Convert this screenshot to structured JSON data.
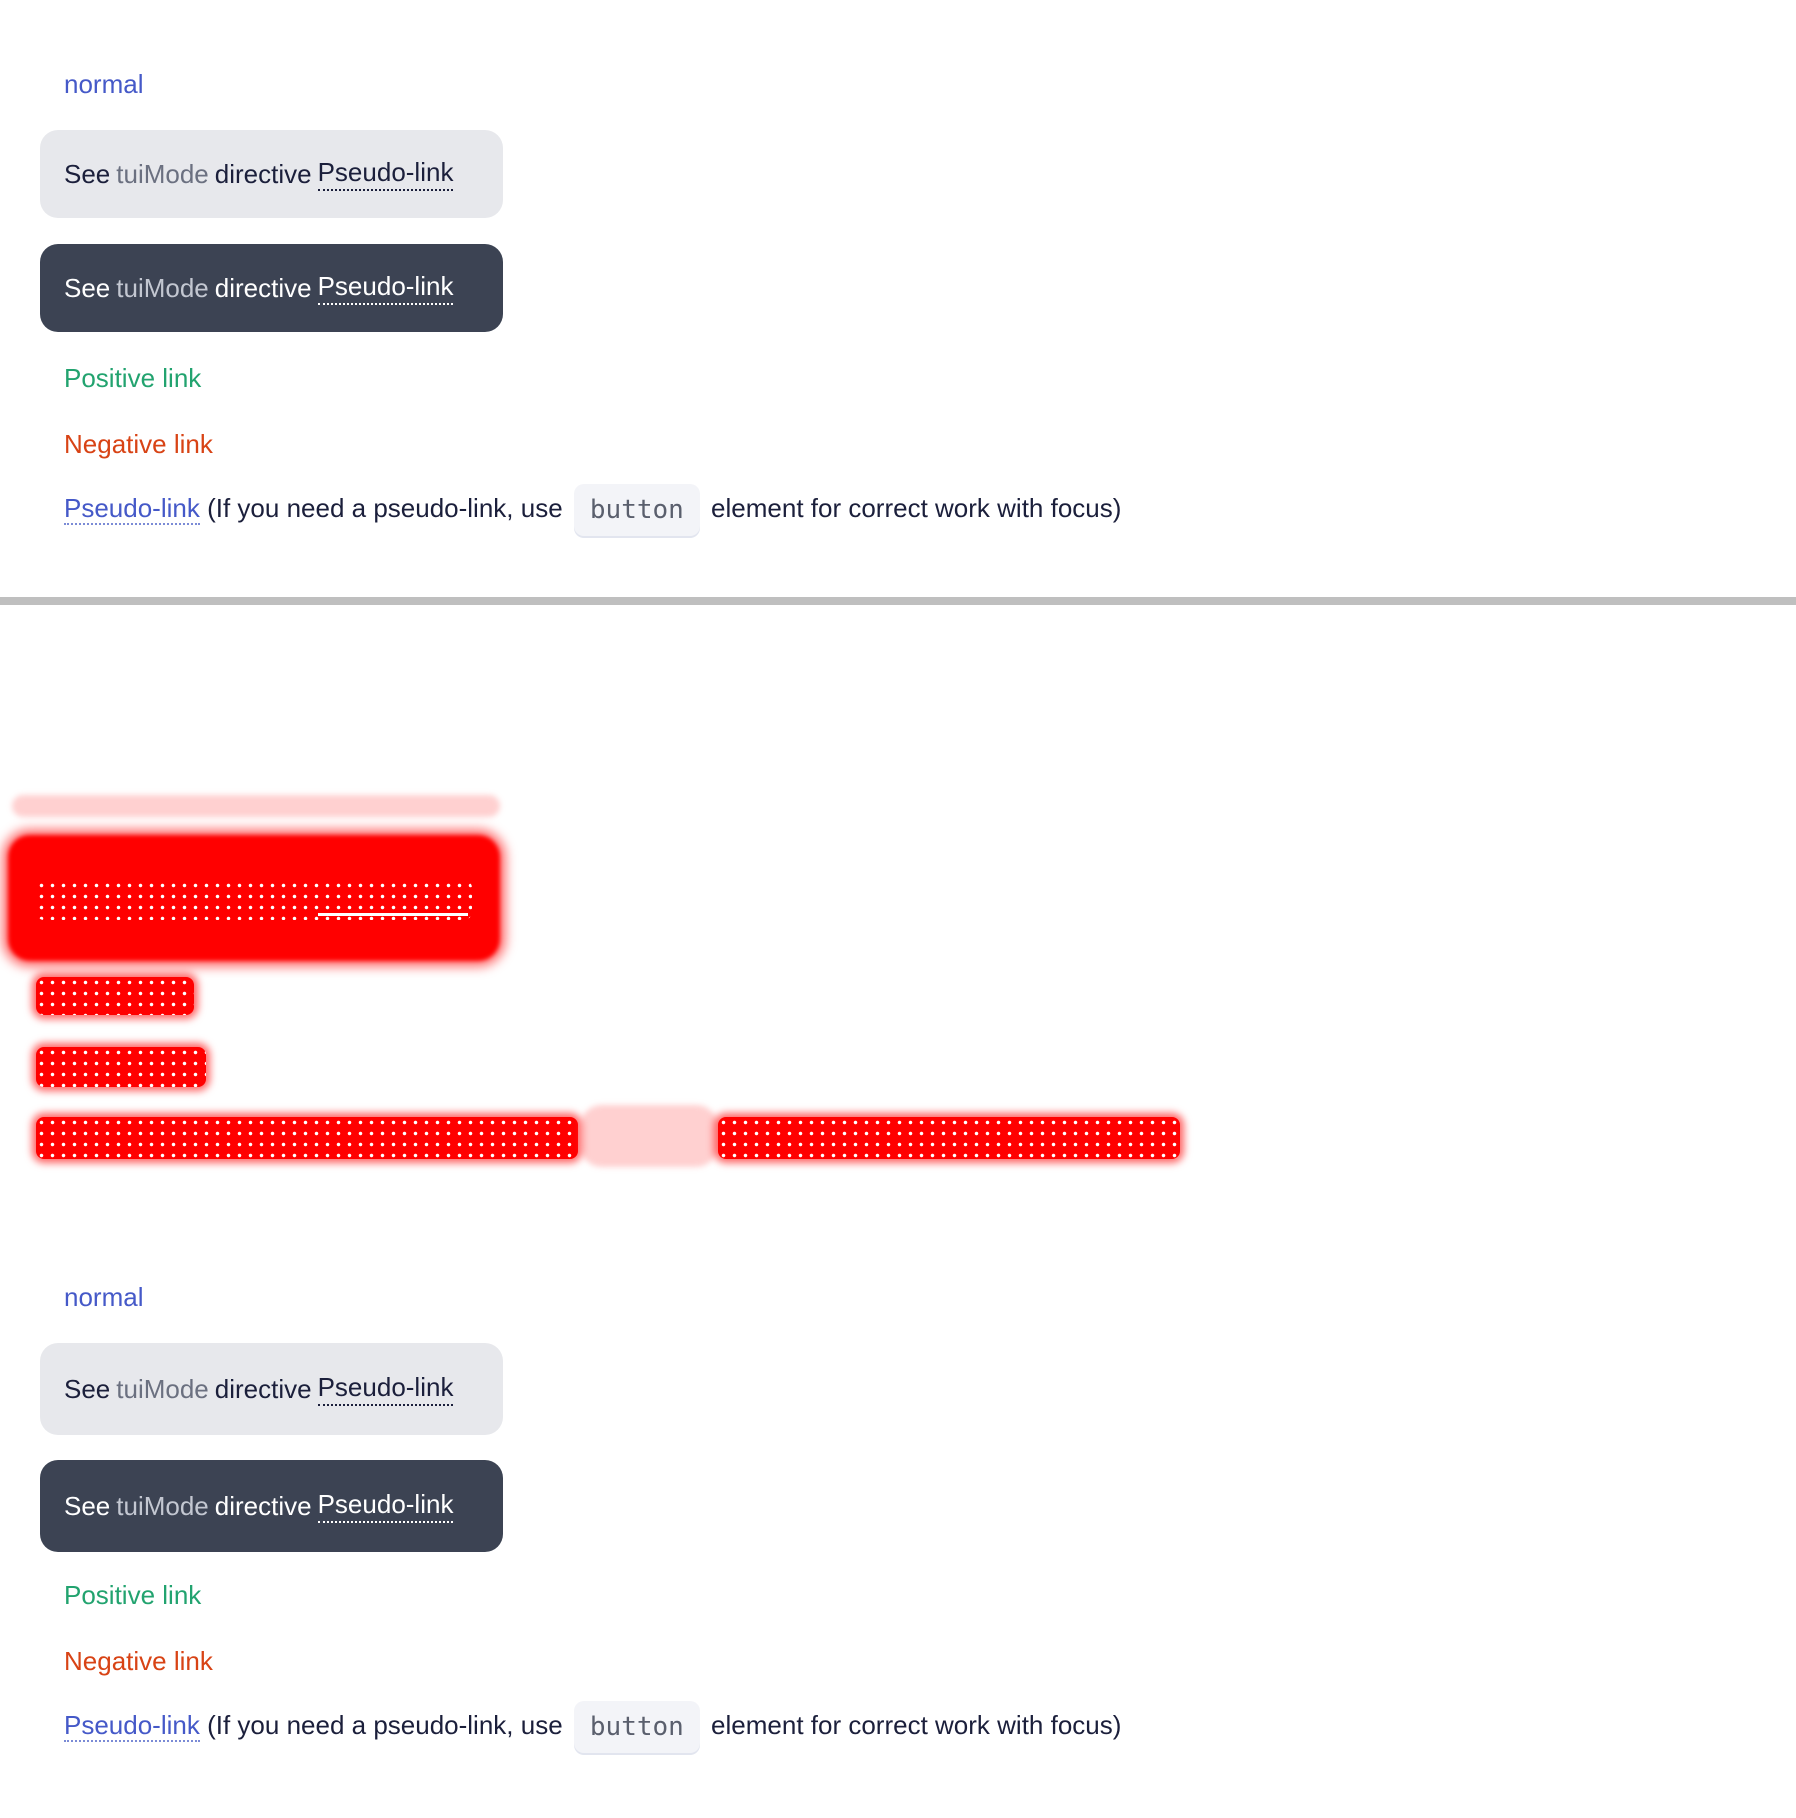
{
  "sections": [
    {
      "normal_link": "normal",
      "box_light": {
        "see": "See",
        "mode": "tuiMode",
        "directive": "directive",
        "pseudo_link": "Pseudo-link"
      },
      "box_dark": {
        "see": "See",
        "mode": "tuiMode",
        "directive": "directive",
        "pseudo_link": "Pseudo-link"
      },
      "positive_link": "Positive link",
      "negative_link": "Negative link",
      "pseudo_row": {
        "pseudo_link": "Pseudo-link",
        "text_before": "(If you need a pseudo-link, use",
        "code": "button",
        "text_after": "element for correct work with focus)"
      }
    },
    {
      "normal_link": "normal",
      "box_light": {
        "see": "See",
        "mode": "tuiMode",
        "directive": "directive",
        "pseudo_link": "Pseudo-link"
      },
      "box_dark": {
        "see": "See",
        "mode": "tuiMode",
        "directive": "directive",
        "pseudo_link": "Pseudo-link"
      },
      "positive_link": "Positive link",
      "negative_link": "Negative link",
      "pseudo_row": {
        "pseudo_link": "Pseudo-link",
        "text_before": "(If you need a pseudo-link, use",
        "code": "button",
        "text_after": "element for correct work with focus)"
      }
    }
  ],
  "colors": {
    "link_normal": "#4559c8",
    "link_positive": "#22a36f",
    "link_negative": "#d84315",
    "dark_box": "#3c4353",
    "light_box": "#e7e8ec",
    "diff_highlight": "#ff0000"
  }
}
